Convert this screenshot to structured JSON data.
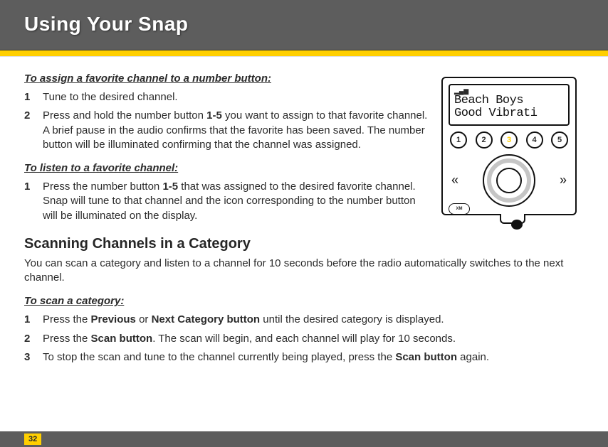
{
  "header": {
    "title": "Using Your Snap"
  },
  "assign": {
    "heading": "To assign a favorite channel to a number button:",
    "steps": [
      {
        "n": "1",
        "text": "Tune to the desired channel."
      },
      {
        "n": "2",
        "pre": "Press and hold the number button ",
        "bold": "1-5",
        "post": " you want to assign to that favorite channel. A brief pause in the audio confirms that the favorite has been saved. The number button will be illuminated confirming that the channel was assigned."
      }
    ]
  },
  "listen": {
    "heading": "To listen to a favorite channel:",
    "steps": [
      {
        "n": "1",
        "pre": "Press the number button ",
        "bold": "1-5",
        "post": " that was assigned to the desired favorite channel. Snap will tune to that channel and the icon corresponding to the number button will be illuminated on the display."
      }
    ]
  },
  "scanning": {
    "heading": "Scanning Channels in a Category",
    "intro": "You can scan a category and listen to a channel for 10 seconds before the radio automatically switches to the next channel.",
    "sub_heading": "To scan a category:",
    "steps": [
      {
        "n": "1",
        "pre": "Press the ",
        "bold": "Previous",
        "mid": " or ",
        "bold2": "Next Category button",
        "post": " until the desired category is displayed."
      },
      {
        "n": "2",
        "pre": "Press the ",
        "bold": "Scan button",
        "post": ". The scan will begin, and each channel will play for 10 seconds."
      },
      {
        "n": "3",
        "pre": "To stop the scan and tune to the channel currently being played, press the ",
        "bold": "Scan button",
        "post": " again."
      }
    ]
  },
  "device": {
    "line1": "Beach Boys",
    "line2": "Good Vibrati",
    "presets": [
      "1",
      "2",
      "3",
      "4",
      "5"
    ],
    "active_preset": "3",
    "brand": "XM"
  },
  "page_number": "32"
}
